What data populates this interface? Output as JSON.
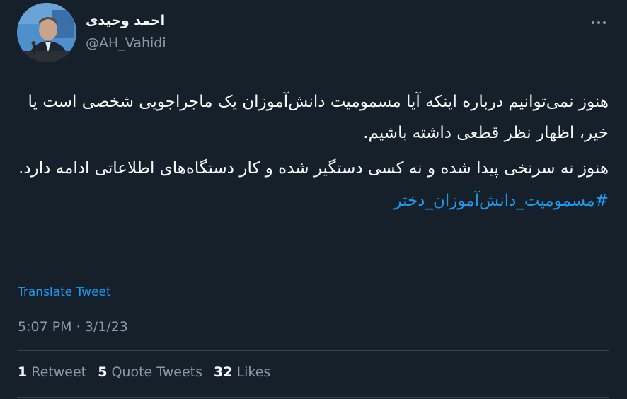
{
  "author": {
    "name": "احمد وحیدی",
    "handle": "@AH_Vahidi"
  },
  "tweet": {
    "paragraph1": "هنوز نمی‌توانیم درباره اینکه آیا مسمومیت دانش‌آموزان یک ماجراجویی شخصی است یا خیر، اظهار نظر قطعی داشته باشیم.",
    "paragraph2": "هنوز نه سرنخی پیدا شده و نه کسی دستگیر شده و کار دستگاه‌های اطلاعاتی ادامه دارد.",
    "hashtag": "#مسمومیت_دانش‌آموزان_دختر"
  },
  "translate_label": "Translate Tweet",
  "time": "5:07 PM",
  "separator": "·",
  "date": "3/1/23",
  "stats": {
    "retweets_count": "1",
    "retweets_label": "Retweet",
    "quotes_count": "5",
    "quotes_label": "Quote Tweets",
    "likes_count": "32",
    "likes_label": "Likes"
  },
  "icons": {
    "more": "more-horizontal-icon"
  },
  "colors": {
    "background": "#15202b",
    "link": "#1d9bf0",
    "secondary_text": "#8b98a5",
    "divider": "#38444d"
  }
}
